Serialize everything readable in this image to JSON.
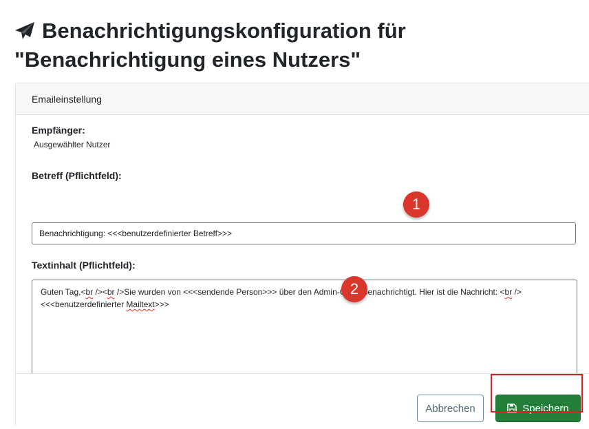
{
  "page": {
    "title": "Benachrichtigungskonfiguration für \"Benachrichtigung eines Nutzers\"",
    "title_icon": "paper-plane-icon"
  },
  "card": {
    "header": "Emaileinstellung",
    "recipient_label": "Empfänger:",
    "recipient_value": "Ausgewählter Nutzer",
    "subject_label": "Betreff (Pflichtfeld):",
    "subject_value": "Benachrichtigung: <<<benutzerdefinierter Betreff>>>",
    "body_label": "Textinhalt (Pflichtfeld):",
    "body_value": {
      "part1": "Guten Tag,<",
      "br1": "br",
      "part2": " /><",
      "br2": "br",
      "part3": " />Sie wurden von <<<sendende Person>>> über den Admin-Client benachrichtigt. Hier ist die Nachricht: <",
      "br3": "br",
      "part4": " /><<<benutzerdefinierter ",
      "mailtext": "Mailtext",
      "part5": ">>>"
    }
  },
  "markers": {
    "one": "1",
    "two": "2"
  },
  "buttons": {
    "cancel": "Abbrechen",
    "save": "Speichern",
    "save_icon": "floppy-disk-icon"
  },
  "colors": {
    "save_button": "#237e3a",
    "marker": "#d9362c",
    "highlight": "#e01e1e"
  }
}
